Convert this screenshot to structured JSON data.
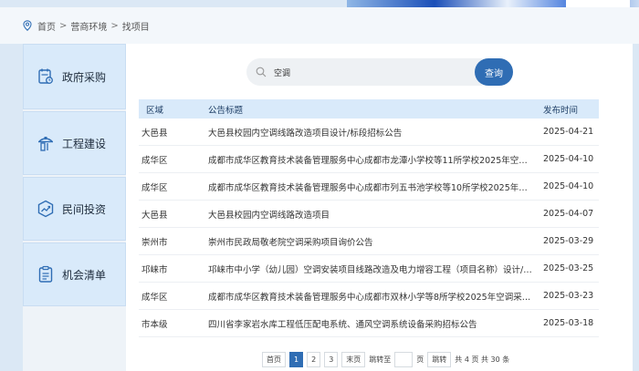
{
  "breadcrumb": {
    "items": [
      "首页",
      "营商环境",
      "找项目"
    ],
    "separator": ">"
  },
  "sidebar": {
    "items": [
      {
        "label": "政府采购",
        "icon": "procurement-icon"
      },
      {
        "label": "工程建设",
        "icon": "construction-icon"
      },
      {
        "label": "民间投资",
        "icon": "investment-icon"
      },
      {
        "label": "机会清单",
        "icon": "checklist-icon"
      }
    ]
  },
  "search": {
    "value": "空调",
    "button_label": "查询"
  },
  "table": {
    "headers": {
      "region": "区域",
      "title": "公告标题",
      "date": "发布时间"
    },
    "rows": [
      {
        "region": "大邑县",
        "title": "大邑县校园内空调线路改造项目设计/标段招标公告",
        "date": "2025-04-21"
      },
      {
        "region": "成华区",
        "title": "成都市成华区教育技术装备管理服务中心成都市龙潭小学校等11所学校2025年空调...",
        "date": "2025-04-10"
      },
      {
        "region": "成华区",
        "title": "成都市成华区教育技术装备管理服务中心成都市列五书池学校等10所学校2025年空...",
        "date": "2025-04-10"
      },
      {
        "region": "大邑县",
        "title": "大邑县校园内空调线路改造项目",
        "date": "2025-04-07"
      },
      {
        "region": "崇州市",
        "title": "崇州市民政局敬老院空调采购项目询价公告",
        "date": "2025-03-29"
      },
      {
        "region": "邛崃市",
        "title": "邛崃市中小学（幼儿园）空调安装项目线路改造及电力增容工程（项目名称）设计/标...",
        "date": "2025-03-25"
      },
      {
        "region": "成华区",
        "title": "成都市成华区教育技术装备管理服务中心成都市双林小学等8所学校2025年空调采购...",
        "date": "2025-03-23"
      },
      {
        "region": "市本级",
        "title": "四川省李家岩水库工程低压配电系统、通风空调系统设备采购招标公告",
        "date": "2025-03-18"
      }
    ]
  },
  "pager": {
    "first": "首页",
    "pages": [
      "1",
      "2",
      "3"
    ],
    "current": "1",
    "last": "末页",
    "jump_to": "跳转至",
    "page_unit": "页",
    "jump": "跳转",
    "summary": "共 4 页 共 30 条"
  },
  "colors": {
    "accent": "#2f6db4",
    "sidebar_item_bg": "#d9eafa",
    "header_bg": "#d9eafa"
  }
}
